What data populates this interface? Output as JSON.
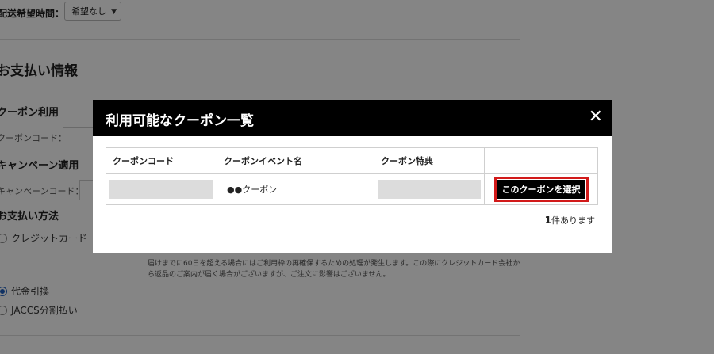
{
  "background": {
    "delivery_time_label": "配送希望時間：",
    "delivery_time_select": "希望なし",
    "payment_section_title": "お支払い情報",
    "coupon_use_title": "クーポン利用",
    "coupon_code_label": "クーポンコード：",
    "campaign_title": "キャンペーン適用",
    "campaign_code_label": "キャンペーンコード：",
    "payment_method_title": "お支払い方法",
    "payment_options": [
      "クレジットカード",
      "代金引換",
      "JACCS分割払い"
    ],
    "notes": [
      "届けまでに60日を超える場合にはご利用枠の再確保するための処理が発生します。この際にクレジットカード会社か",
      "ら返品のご案内が届く場合がございますが、ご注文に影響はございません。"
    ]
  },
  "modal": {
    "title": "利用可能なクーポン一覧",
    "close_icon": "close-icon",
    "columns": [
      "クーポンコード",
      "クーポンイベント名",
      "クーポン特典",
      ""
    ],
    "rows": [
      {
        "event_name": "●●クーポン",
        "action_label": "このクーポンを選択"
      }
    ],
    "count_number": "1",
    "count_suffix": "件あります"
  },
  "colors": {
    "modal_header": "#000000",
    "highlight_border": "#d21a1a",
    "overlay": "rgba(0,0,0,0.48)"
  }
}
